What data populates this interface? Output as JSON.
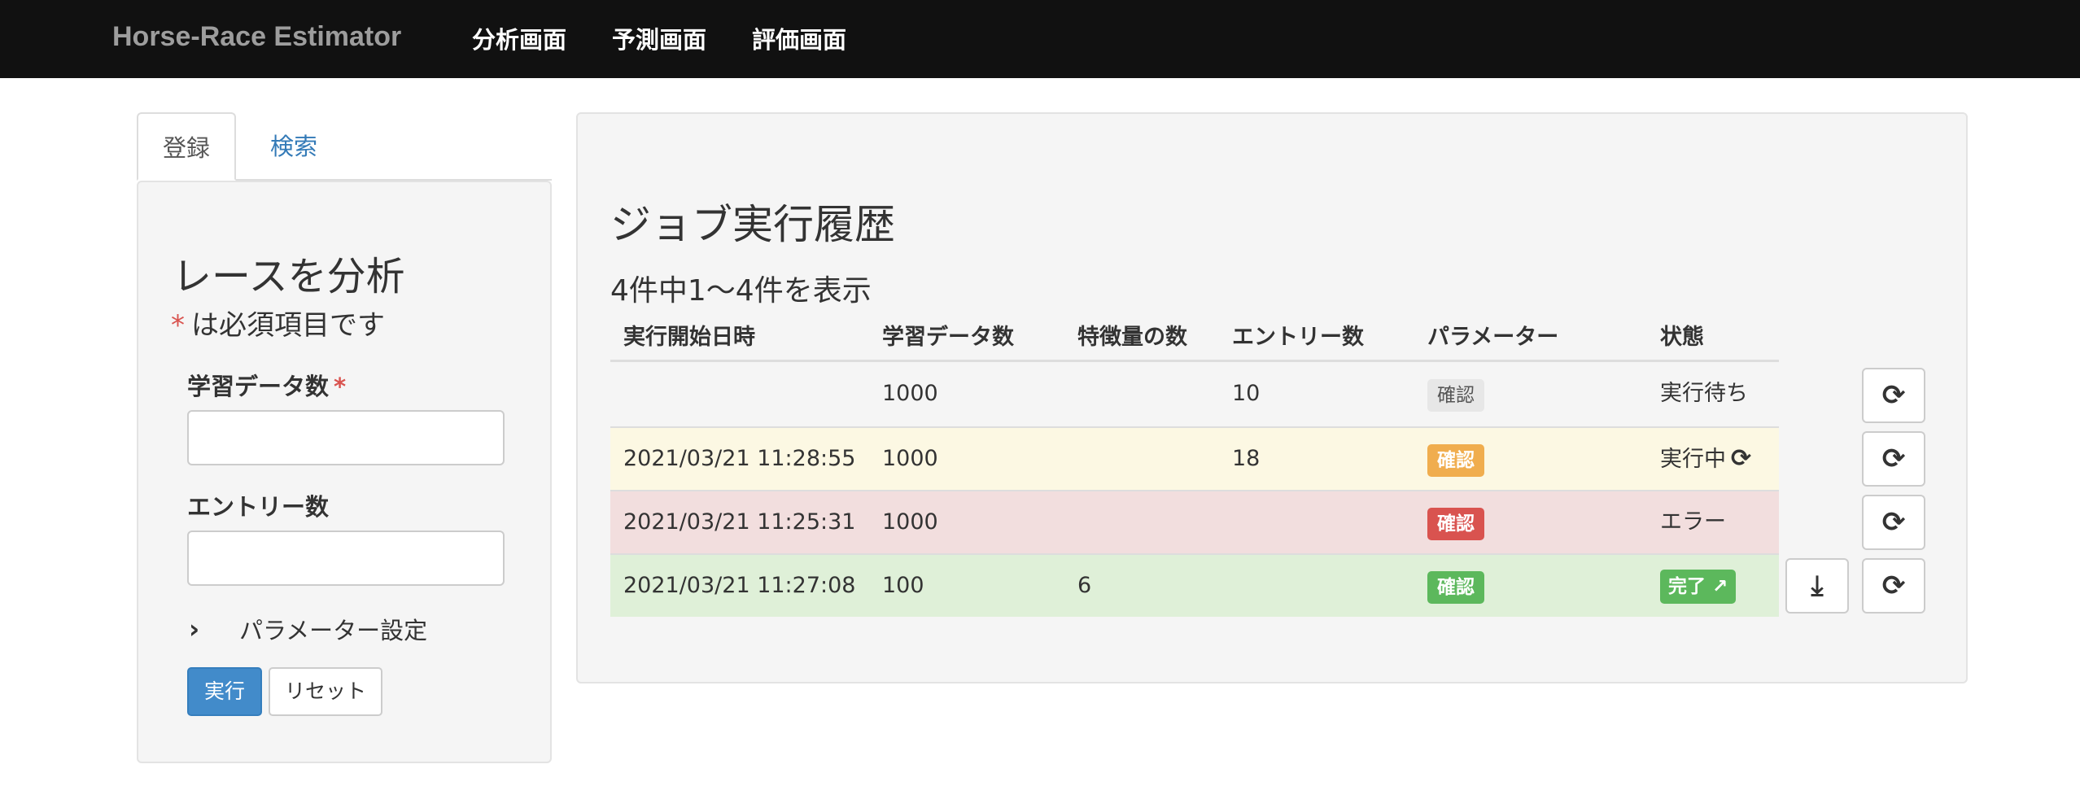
{
  "navbar": {
    "brand": "Horse-Race Estimator",
    "links": [
      "分析画面",
      "予測画面",
      "評価画面"
    ]
  },
  "tabs": [
    "登録",
    "検索"
  ],
  "form": {
    "title": "レースを分析",
    "required_star": "*",
    "required_note": "は必須項目です",
    "fields": [
      {
        "label": "学習データ数",
        "required": true,
        "value": ""
      },
      {
        "label": "エントリー数",
        "required": false,
        "value": ""
      }
    ],
    "param_toggle": "パラメーター設定",
    "run_button": "実行",
    "reset_button": "リセット"
  },
  "jobs": {
    "title": "ジョブ実行履歴",
    "count_text": "4件中1〜4件を表示",
    "headers": [
      "実行開始日時",
      "学習データ数",
      "特徴量の数",
      "エントリー数",
      "パラメーター",
      "状態"
    ],
    "rows": [
      {
        "start": "",
        "train": "1000",
        "features": "",
        "entries": "10",
        "param": "確認",
        "status": "実行待ち",
        "state": "waiting"
      },
      {
        "start": "2021/03/21 11:28:55",
        "train": "1000",
        "features": "",
        "entries": "18",
        "param": "確認",
        "status": "実行中",
        "state": "running"
      },
      {
        "start": "2021/03/21 11:25:31",
        "train": "1000",
        "features": "",
        "entries": "",
        "param": "確認",
        "status": "エラー",
        "state": "error"
      },
      {
        "start": "2021/03/21 11:27:08",
        "train": "100",
        "features": "6",
        "entries": "",
        "param": "確認",
        "status": "完了",
        "state": "done"
      }
    ],
    "row_colors": {
      "waiting": "#f5f5f5",
      "running": "#fcf8e3",
      "error": "#f2dede",
      "done": "#dff0d8"
    },
    "icons": {
      "reload": "⟳",
      "download": "⤓",
      "spin": "⟳",
      "external": "↗"
    }
  }
}
